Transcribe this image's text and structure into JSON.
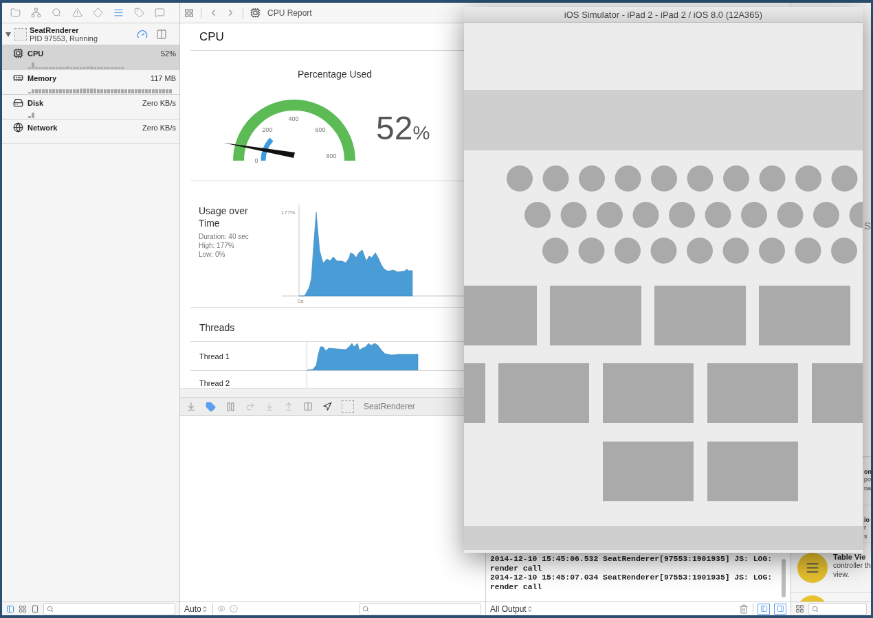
{
  "navigator": {
    "tabs": [
      {
        "kind": "folder",
        "selected": false
      },
      {
        "kind": "hierarchy",
        "selected": false
      },
      {
        "kind": "search",
        "selected": false
      },
      {
        "kind": "warning",
        "selected": false
      },
      {
        "kind": "breakpoint",
        "selected": false
      },
      {
        "kind": "debug",
        "selected": true
      },
      {
        "kind": "tag",
        "selected": false
      },
      {
        "kind": "log",
        "selected": false
      }
    ],
    "process": {
      "name": "SeatRenderer",
      "status": "PID 97553, Running",
      "expanded": true
    },
    "gauges": [
      {
        "kind": "cpu",
        "name": "CPU",
        "value": "52%",
        "selected": true
      },
      {
        "kind": "memory",
        "name": "Memory",
        "value": "117 MB",
        "selected": false
      },
      {
        "kind": "disk",
        "name": "Disk",
        "value": "Zero KB/s",
        "selected": false
      },
      {
        "kind": "network",
        "name": "Network",
        "value": "Zero KB/s",
        "selected": false
      }
    ]
  },
  "editor": {
    "breadcrumb": "CPU Report",
    "report": {
      "title": "CPU",
      "gauge": {
        "title": "Percentage Used",
        "ticks": [
          "0",
          "200",
          "400",
          "600",
          "800"
        ],
        "value": "52",
        "unit": "%"
      },
      "usage": {
        "title": "Usage over Time",
        "stats": [
          "Duration: 40 sec",
          "High: 177%",
          "Low: 0%"
        ],
        "y_label": "177%",
        "x_label": "0s"
      },
      "threads": {
        "title": "Threads",
        "rows": [
          {
            "name": "Thread 1",
            "activity": true
          },
          {
            "name": "Thread 2",
            "activity": false
          }
        ]
      }
    }
  },
  "debug_bar": {
    "process": "SeatRenderer",
    "breakpoints_active": true
  },
  "variables": {
    "scope": "Auto"
  },
  "console": {
    "lines": [
      "2014-12-10 15:45:06.532 SeatRenderer[97553:1901935] JS: LOG: render call",
      "2014-12-10 15:45:07.034 SeatRenderer[97553:1901935] JS: LOG: render call"
    ],
    "filter": "All Output"
  },
  "inspector": {
    "fragment": "S"
  },
  "library": {
    "items": [
      {
        "kind": "clipped",
        "title": "on",
        "lines": [
          "po",
          "na"
        ]
      },
      {
        "kind": "clipped",
        "title": "io",
        "lines": [
          "r",
          "s"
        ]
      },
      {
        "kind": "full",
        "title": "Table Vie",
        "lines": [
          "controller th",
          "view."
        ]
      },
      {
        "kind": "icon_only"
      }
    ]
  },
  "simulator": {
    "title": "iOS Simulator - iPad 2 - iPad 2 / iOS 8.0 (12A365)"
  }
}
